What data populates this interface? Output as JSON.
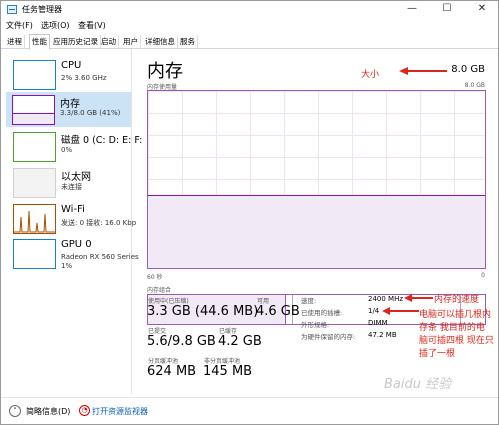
{
  "window": {
    "title": "任务管理器",
    "controls": {
      "minimize": "—",
      "maximize": "☐",
      "close": "✕"
    }
  },
  "menu": [
    "文件(F)",
    "选项(O)",
    "查看(V)"
  ],
  "tabs": [
    "进程",
    "性能",
    "应用历史记录",
    "启动",
    "用户",
    "详细信息",
    "服务"
  ],
  "active_tab": "性能",
  "sidebar": [
    {
      "name": "CPU",
      "sub": "2% 3.60 GHz",
      "sub2": ""
    },
    {
      "name": "内存",
      "sub": "3.3/8.0 GB (41%)",
      "sub2": ""
    },
    {
      "name": "磁盘 0 (C: D: E: F:",
      "sub": "0%",
      "sub2": ""
    },
    {
      "name": "以太网",
      "sub": "未连接",
      "sub2": ""
    },
    {
      "name": "Wi-Fi",
      "sub": "发送: 0 接收: 16.0 Kbp",
      "sub2": ""
    },
    {
      "name": "GPU 0",
      "sub": "Radeon RX 560 Series",
      "sub2": "1%"
    }
  ],
  "memory": {
    "title": "内存",
    "total": "8.0 GB",
    "usage_label": "内存使用量",
    "usage_max": "8.0 GB",
    "usage_fraction": 0.41,
    "time_left": "60 秒",
    "time_right": "0",
    "composition_label": "内存组合",
    "composition_used_fraction": 0.41,
    "composition_modified_fraction": 0.02,
    "composition_standby_fraction": 0.5,
    "stats": {
      "in_use_label": "使用中(已压缩)",
      "in_use_value": "3.3 GB (44.6 MB)",
      "available_label": "可用",
      "available_value": "4.6 GB",
      "committed_label": "已提交",
      "committed_value": "5.6/9.8 GB",
      "cached_label": "已缓存",
      "cached_value": "4.2 GB",
      "paged_label": "分页缓冲池",
      "paged_value": "624 MB",
      "nonpaged_label": "非分页缓冲池",
      "nonpaged_value": "145 MB"
    },
    "specs": [
      {
        "label": "速度:",
        "value": "2400 MHz"
      },
      {
        "label": "已使用的插槽:",
        "value": "1/4"
      },
      {
        "label": "外形规格:",
        "value": "DIMM"
      },
      {
        "label": "为硬件保留的内存:",
        "value": "47.2 MB"
      }
    ]
  },
  "annotations": {
    "size": "大小",
    "speed": "内存的速度",
    "slots_line1": "电脑可以插几根内",
    "slots_line2": "存条   我目前的电",
    "slots_line3": "脑可插四根  现在只",
    "slots_line4": "插了一根"
  },
  "footer": {
    "fewer_details": "简略信息(D)",
    "resource_monitor": "打开资源监视器"
  },
  "watermark": "Baidu 经验",
  "colors": {
    "memory": "#8b12ae",
    "annotation": "#d6281c",
    "link": "#0b5bb5",
    "selected": "#cce3f6"
  }
}
